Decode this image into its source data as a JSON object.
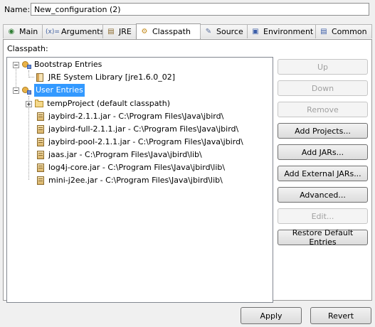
{
  "name_field": {
    "label": "Name:",
    "value": "New_configuration (2)"
  },
  "tabs": [
    {
      "label": "Main",
      "icon": "main-icon"
    },
    {
      "label": "Arguments",
      "icon": "arguments-icon",
      "icon_text": "(x)="
    },
    {
      "label": "JRE",
      "icon": "jre-icon"
    },
    {
      "label": "Classpath",
      "icon": "classpath-icon",
      "active": true
    },
    {
      "label": "Source",
      "icon": "source-icon"
    },
    {
      "label": "Environment",
      "icon": "environment-icon"
    },
    {
      "label": "Common",
      "icon": "common-icon"
    }
  ],
  "classpath": {
    "label": "Classpath:",
    "tree": {
      "bootstrap": {
        "label": "Bootstrap Entries",
        "children": [
          "JRE System Library [jre1.6.0_02]"
        ]
      },
      "user": {
        "label": "User Entries",
        "children": [
          "tempProject (default classpath)",
          "jaybird-2.1.1.jar - C:\\Program Files\\Java\\jbird\\",
          "jaybird-full-2.1.1.jar - C:\\Program Files\\Java\\jbird\\",
          "jaybird-pool-2.1.1.jar - C:\\Program Files\\Java\\jbird\\",
          "jaas.jar - C:\\Program Files\\Java\\jbird\\lib\\",
          "log4j-core.jar - C:\\Program Files\\Java\\jbird\\lib\\",
          "mini-j2ee.jar - C:\\Program Files\\Java\\jbird\\lib\\"
        ]
      }
    }
  },
  "buttons": {
    "up": "Up",
    "down": "Down",
    "remove": "Remove",
    "add_projects": "Add Projects...",
    "add_jars": "Add JARs...",
    "add_external_jars": "Add External JARs...",
    "advanced": "Advanced...",
    "edit": "Edit...",
    "restore_defaults": "Restore Default Entries",
    "apply": "Apply",
    "revert": "Revert"
  },
  "colors": {
    "selection": "#3399ff",
    "window_bg": "#f0f0f0"
  }
}
